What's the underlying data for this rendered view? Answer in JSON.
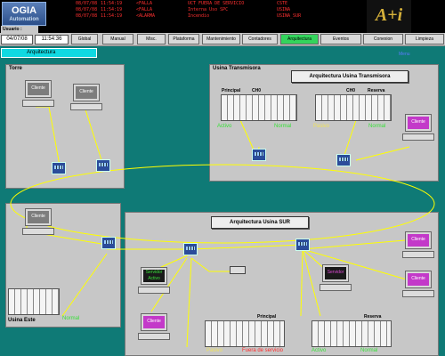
{
  "header": {
    "logo_text": "OGIA",
    "logo_sub": "Automation",
    "brand_logo": "A+i",
    "alarms": [
      [
        "08/07/08",
        "11:54:19",
        "<FALLA",
        "UCT FUERA DE SERVICIO",
        "CSTE"
      ],
      [
        "08/07/08",
        "11:54:19",
        "<FALLA",
        "Interna Uso SPC",
        "USINA"
      ],
      [
        "08/07/08",
        "11:54:19",
        "<ALARMA",
        "Incendio",
        "USINA_SUR"
      ]
    ]
  },
  "toolbar": {
    "user_label": "Usuario :",
    "date": "04/07/08",
    "time": "11:54:36",
    "buttons": [
      "Global",
      "Manual",
      "Misc.",
      "Plataforma",
      "Mantenimiento",
      "Contadores",
      "Arquitectura",
      "Eventos",
      "Conexion",
      "Limpieza"
    ],
    "active": "Arquitectura"
  },
  "section_title": "Arquitectura",
  "menu_link": "Menu",
  "torre": {
    "label": "Torre",
    "pc1": "Cliente",
    "pc2": "Cliente"
  },
  "transmisora": {
    "label": "Usina Transmisora",
    "title": "Arquitectura Usina Transmisora",
    "principal": "Principal",
    "reserva": "Reserva",
    "ch1": "CH0",
    "ch2": "CH0",
    "activo": "Activo",
    "normal1": "Normal",
    "pasivo": "Pasivo",
    "normal2": "Normal",
    "pc": "Cliente"
  },
  "este": {
    "label": "Usina Este",
    "pc": "Cliente",
    "normal": "Normal"
  },
  "sur": {
    "title": "Arquitectura Usina SUR",
    "servidor1_a": "Servidor",
    "servidor1_b": "Activo",
    "servidor2": "Servidor",
    "cliente1": "Cliente",
    "cliente2": "Cliente",
    "cliente3": "Cliente",
    "principal": "Principal",
    "reserva": "Reserva",
    "pasivo": "Pasivo",
    "fuera": "Fuera de servicio",
    "activo": "Activo",
    "normal": "Normal"
  }
}
